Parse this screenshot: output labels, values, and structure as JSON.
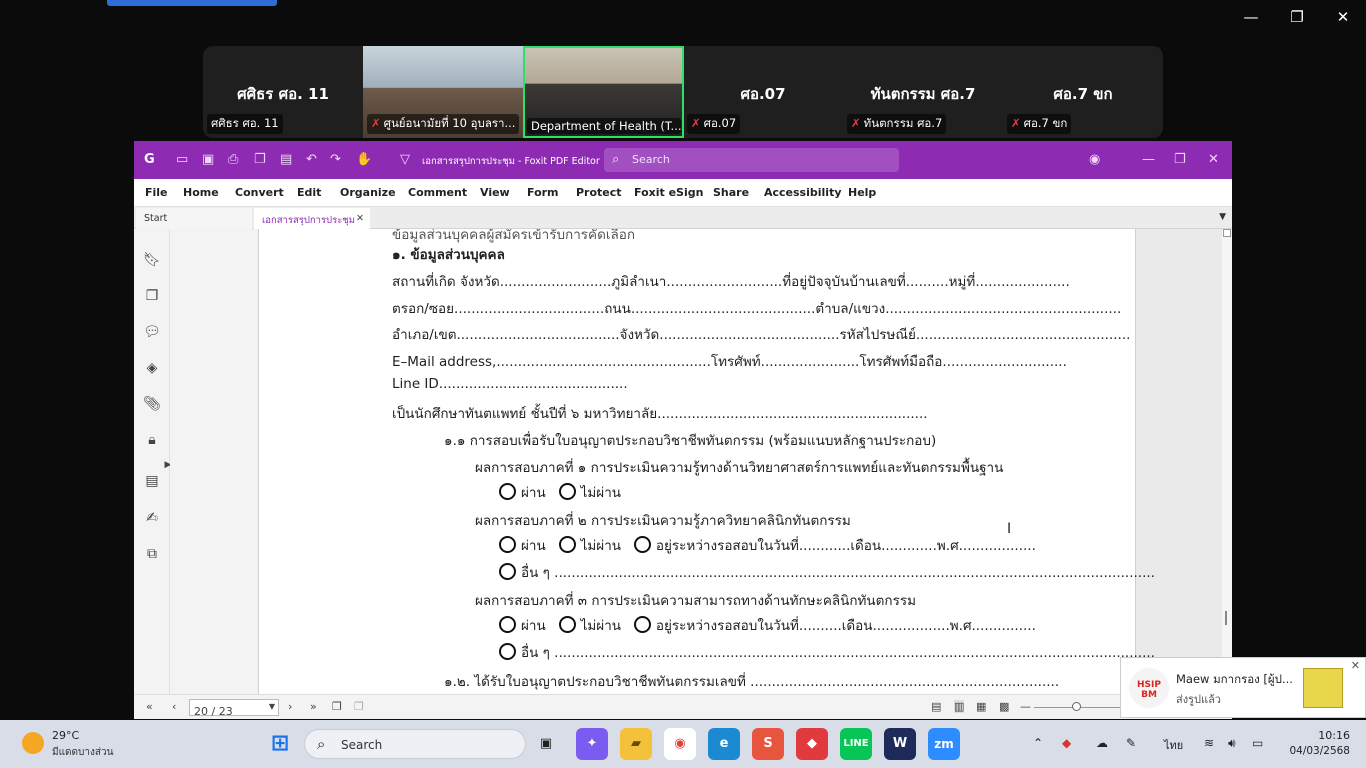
{
  "zoom": {
    "window_controls": {
      "minimize": "—",
      "restore": "❐",
      "close": "✕"
    },
    "participants": [
      {
        "display": "ศศิธร ศอ. 11",
        "name": "ศศิธร ศอ. 11",
        "muted": false,
        "video": false
      },
      {
        "display": "",
        "name": "ศูนย์อนามัยที่ 10 อุบลรา...",
        "muted": true,
        "video": true
      },
      {
        "display": "",
        "name": "Department of Health (T...",
        "muted": false,
        "video": true,
        "active": true
      },
      {
        "display": "ศอ.07",
        "name": "ศอ.07",
        "muted": true,
        "video": false
      },
      {
        "display": "ทันตกรรม ศอ.7",
        "name": "ทันตกรรม ศอ.7",
        "muted": true,
        "video": false
      },
      {
        "display": "ศอ.7 ขก",
        "name": "ศอ.7 ขก",
        "muted": true,
        "video": false
      }
    ]
  },
  "foxit": {
    "title": "เอกสารสรุปการประชุม - Foxit PDF Editor",
    "search_placeholder": "Search",
    "menu": [
      "File",
      "Home",
      "Convert",
      "Edit",
      "Organize",
      "Comment",
      "View",
      "Form",
      "Protect",
      "Foxit eSign",
      "Share",
      "Accessibility",
      "Help"
    ],
    "tabs": [
      {
        "label": "Start",
        "active": false
      },
      {
        "label": "เอกสารสรุปการประชุม",
        "active": true
      }
    ],
    "page_indicator": "20 / 23",
    "document_lines": [
      "๑. ข้อมูลส่วนบุคคล",
      "สถานที่เกิด  จังหวัด..........................ภูมิลำเนา...........................ที่อยู่ปัจจุบันบ้านเลขที่..........หมู่ที่......................",
      "ตรอก/ซอย...................................ถนน...........................................ตำบล/แขวง.......................................................",
      "อำเภอ/เขต......................................จังหวัด..........................................รหัสไปรษณีย์..................................................",
      "E–Mail address,..................................................โทรศัพท์.......................โทรศัพท์มือถือ.............................",
      "Line ID............................................",
      "เป็นนักศึกษาทันตแพทย์ ชั้นปีที่ ๖ มหาวิทยาลัย...............................................................",
      "๑.๑ การสอบเพื่อรับใบอนุญาตประกอบวิชาชีพทันตกรรม (พร้อมแนบหลักฐานประกอบ)",
      "ผลการสอบภาคที่ ๑ การประเมินความรู้ทางด้านวิทยาศาสตร์การแพทย์และทันตกรรมพื้นฐาน",
      "ผลการสอบภาคที่ ๒  การประเมินความรู้ภาควิทยาคลินิกทันตกรรม",
      "ผลการสอบภาคที่ ๓  การประเมินความสามารถทางด้านทักษะคลินิกทันตกรรม",
      "๑.๒. ได้รับใบอนุญาตประกอบวิชาชีพทันตกรรมเลขที่ ........................................................................"
    ],
    "options": {
      "pass": "ผ่าน",
      "fail": "ไม่ผ่าน",
      "pending": "อยู่ระหว่างรอสอบในวันที่............เดือน.............พ.ศ..................",
      "pending2": "อยู่ระหว่างรอสอบในวันที่..........เดือน..................พ.ศ...............",
      "other": "อื่น ๆ ............................................................................................................................................"
    }
  },
  "notification": {
    "sender": "Maew มกากรอง [ผู้ป...",
    "message": "ส่งรูปแล้ว",
    "app_badge": "HSIP BM"
  },
  "taskbar": {
    "weather_temp": "29°C",
    "weather_desc": "มีแดดบางส่วน",
    "search_label": "Search",
    "language": "ไทย",
    "time": "10:16",
    "date": "04/03/2568"
  }
}
